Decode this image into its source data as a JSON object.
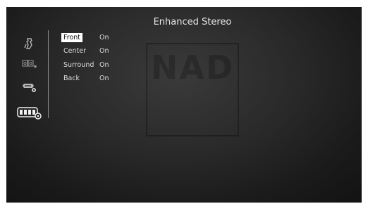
{
  "title": "Enhanced Stereo",
  "sidebar": {
    "items": [
      {
        "icon": "speaker-setup-icon"
      },
      {
        "icon": "source-input-icon"
      },
      {
        "icon": "speaker-settings-icon"
      },
      {
        "icon": "listening-mode-icon"
      }
    ]
  },
  "settings": [
    {
      "label": "Front",
      "value": "On",
      "selected": true
    },
    {
      "label": "Center",
      "value": "On",
      "selected": false
    },
    {
      "label": "Surround",
      "value": "On",
      "selected": false
    },
    {
      "label": "Back",
      "value": "On",
      "selected": false
    }
  ],
  "watermark": {
    "text": "NAD"
  },
  "colors": {
    "background": "#2a2a2a",
    "text": "#dcdcdc",
    "highlight": "#ffffff",
    "highlight_text": "#111111"
  }
}
